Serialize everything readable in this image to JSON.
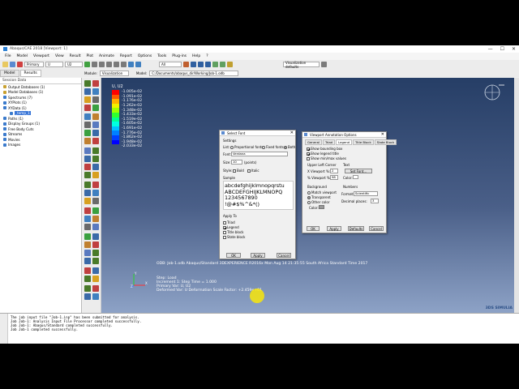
{
  "window": {
    "title": "Abaqus/CAE 2018 [Viewport: 1]",
    "controls": [
      "—",
      "☐",
      "✕"
    ]
  },
  "menu": [
    "File",
    "Model",
    "Viewport",
    "View",
    "Result",
    "Plot",
    "Animate",
    "Report",
    "Options",
    "Tools",
    "Plug-ins",
    "Help",
    "?"
  ],
  "toolbar": {
    "primary_combo": "Primary",
    "variable_combo": "U",
    "component_combo": "U2",
    "all_combo": "All",
    "visualization_defaults": "Visualization defaults"
  },
  "context_bar": {
    "module_label": "Module:",
    "module_value": "Visualization",
    "model_label": "Model:",
    "model_value": "C:/Documents/abaqus_dir/Working/Job-1.odb"
  },
  "tabs": [
    "Model",
    "Results"
  ],
  "tree": {
    "header": "Session Data",
    "items": [
      {
        "label": "Output Databases (1)",
        "indent": 1,
        "color": "#c8a030"
      },
      {
        "label": "Model Databases (1)",
        "indent": 1,
        "color": "#c8a030"
      },
      {
        "label": "Spectrums (7)",
        "indent": 1,
        "color": "#3a7acc"
      },
      {
        "label": "XYPlots (1)",
        "indent": 1,
        "color": "#3a7acc"
      },
      {
        "label": "XYData (1)",
        "indent": 1,
        "color": "#3a7acc"
      },
      {
        "label": "_temp_1",
        "indent": 3,
        "color": "#3a7acc",
        "selected": true
      },
      {
        "label": "Paths (1)",
        "indent": 1,
        "color": "#3a7acc"
      },
      {
        "label": "Display Groups (1)",
        "indent": 1,
        "color": "#3a7acc"
      },
      {
        "label": "Free Body Cuts",
        "indent": 1,
        "color": "#3a7acc"
      },
      {
        "label": "Streams",
        "indent": 1,
        "color": "#3a7acc"
      },
      {
        "label": "Movies",
        "indent": 1,
        "color": "#3a7acc"
      },
      {
        "label": "Images",
        "indent": 1,
        "color": "#3a7acc"
      }
    ]
  },
  "legend": {
    "title": "U, U2",
    "rows": [
      {
        "value": "-1.005e-02",
        "color": "#ff0000"
      },
      {
        "value": "-1.091e-02",
        "color": "#ff5a00"
      },
      {
        "value": "-1.176e-02",
        "color": "#ffb000"
      },
      {
        "value": "-1.262e-02",
        "color": "#f0f000"
      },
      {
        "value": "-1.348e-02",
        "color": "#a0ff00"
      },
      {
        "value": "-1.433e-02",
        "color": "#30ff30"
      },
      {
        "value": "-1.519e-02",
        "color": "#00ff90"
      },
      {
        "value": "-1.605e-02",
        "color": "#00ffe0"
      },
      {
        "value": "-1.691e-02",
        "color": "#00c0ff"
      },
      {
        "value": "-1.776e-02",
        "color": "#0080ff"
      },
      {
        "value": "-1.862e-02",
        "color": "#0040ff"
      },
      {
        "value": "-1.948e-02",
        "color": "#0000ff"
      },
      {
        "value": "-2.033e-02",
        "color": null
      }
    ]
  },
  "viewport": {
    "odb_line": "ODB:  Job-1.odb     Abaqus/Standard 3DEXPERIENCE R2016x     Mon Aug 14 21:35:55 South Africa Standard Time 2017",
    "step_lines": [
      "Step: Load",
      "Increment     1: Step Time =    1.000",
      "Primary Var: U, U2",
      "Deformed Var: U   Deformation Scale Factor: +2.459e+01"
    ],
    "logo": "3DS SIMULIA"
  },
  "select_font": {
    "title": "Select Font",
    "settings_label": "Settings",
    "list_label": "List:",
    "list_options": [
      "Proportional fonts",
      "Fixed fonts",
      "Both"
    ],
    "font_label": "Font:",
    "font_value": "Verdana",
    "size_label": "Size:",
    "size_value": "10",
    "size_unit": "(points)",
    "style_label": "Style:",
    "style_options": [
      "Bold",
      "Italic"
    ],
    "sample_label": "Sample",
    "sample_lines": [
      "abcdefghijklmnopqrstu",
      "ABCDEFGHIJKLMNOPQ",
      "1234567890",
      "!@#$%^&*()"
    ],
    "apply_to_label": "Apply To",
    "apply_items": [
      {
        "label": "Triad",
        "checked": false
      },
      {
        "label": "Legend",
        "checked": true
      },
      {
        "label": "Title block",
        "checked": false
      },
      {
        "label": "State block",
        "checked": false
      }
    ],
    "buttons": [
      "OK",
      "Apply",
      "Cancel"
    ]
  },
  "annotation_options": {
    "title": "Viewport Annotation Options",
    "tabs": [
      "General",
      "Triad",
      "Legend",
      "Title Block",
      "State Block"
    ],
    "checks": [
      {
        "label": "Show bounding box",
        "checked": true
      },
      {
        "label": "Show legend title",
        "checked": true
      },
      {
        "label": "Show min/max values",
        "checked": false
      }
    ],
    "upper_left_label": "Upper Left Corner",
    "x_label": "X Viewport %:",
    "x_value": "2",
    "y_label": "% Viewport %:",
    "y_value": "98",
    "text_label": "Text",
    "set_font_button": "Set Font...",
    "color_label": "Color:",
    "background_label": "Background",
    "bg_options": [
      {
        "label": "Match viewport",
        "on": false
      },
      {
        "label": "Transparent",
        "on": true
      },
      {
        "label": "Other color",
        "on": false
      }
    ],
    "color_small_label": "Color:",
    "numbers_label": "Numbers",
    "format_label": "Format:",
    "format_value": "Scientific",
    "decimal_label": "Decimal places:",
    "decimal_value": "3",
    "buttons": [
      "OK",
      "Apply",
      "Defaults",
      "Cancel"
    ]
  },
  "message_area": {
    "lines": [
      "The job input file \"Job-1.inp\" has been submitted for analysis.",
      "Job Job-1: Analysis Input File Processor completed successfully.",
      "Job Job-1: Abaqus/Standard completed successfully.",
      "Job Job-1 completed successfully."
    ]
  }
}
